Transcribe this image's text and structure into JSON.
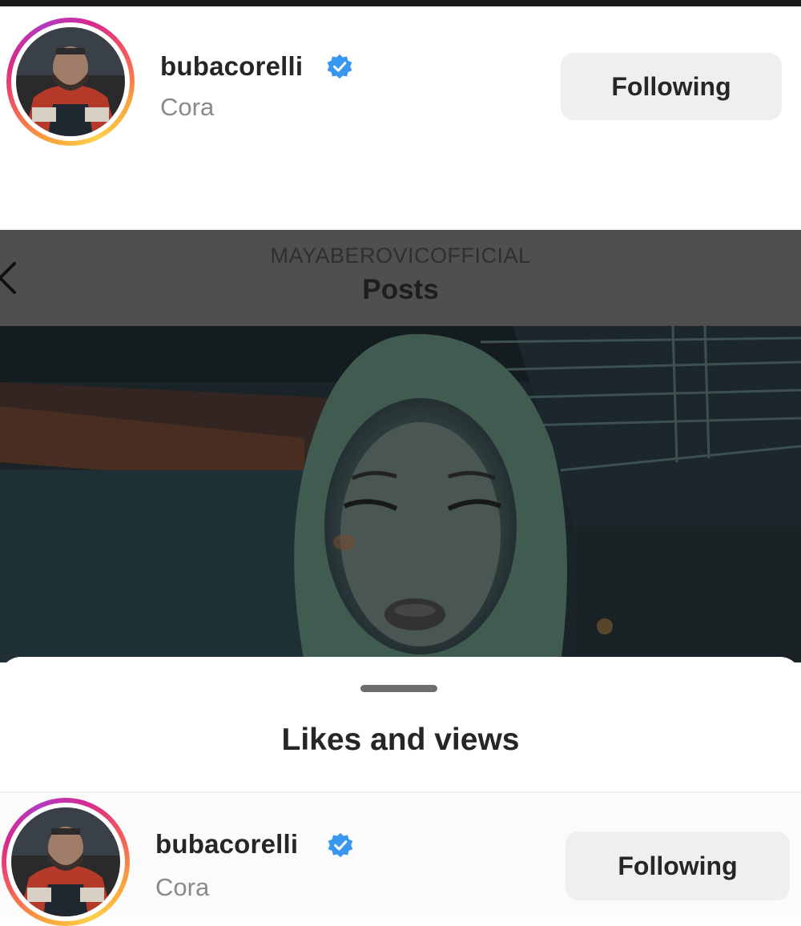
{
  "top_user": {
    "username": "bubacorelli",
    "subtitle": "Cora",
    "follow_label": "Following",
    "verified_icon": "verified-badge-icon"
  },
  "posts_screen": {
    "account": "MAYABEROVICOFFICIAL",
    "title": "Posts",
    "back_icon": "chevron-left-icon"
  },
  "sheet": {
    "title": "Likes and views"
  },
  "bottom_user": {
    "username": "bubacorelli",
    "subtitle": "Cora",
    "follow_label": "Following",
    "verified_icon": "verified-badge-icon"
  },
  "colors": {
    "verified_blue": "#3897f0",
    "button_bg": "#efefef",
    "dim_overlay": "#4f4f4f",
    "ring_start": "#f9a33b",
    "ring_mid": "#d62a8f"
  }
}
